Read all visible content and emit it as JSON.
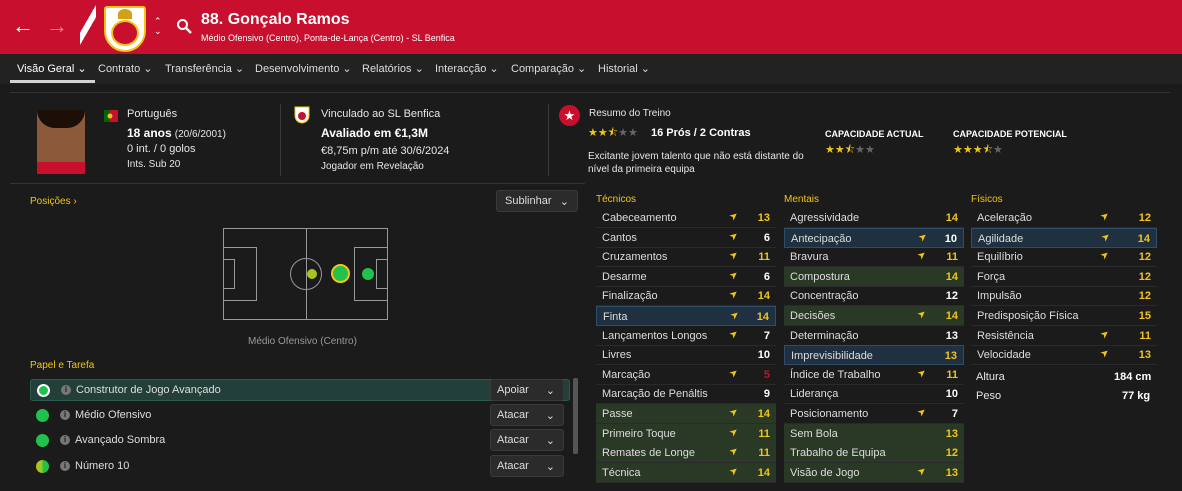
{
  "header": {
    "number_name": "88. Gonçalo Ramos",
    "subtitle": "Médio Ofensivo (Centro), Ponta-de-Lança (Centro) - SL Benfica"
  },
  "nav": {
    "tabs": [
      "Visão Geral",
      "Contrato",
      "Transferência",
      "Desenvolvimento",
      "Relatórios",
      "Interacção",
      "Comparação",
      "Historial"
    ]
  },
  "profile": {
    "nationality": "Português",
    "age": "18 anos",
    "dob": "(20/6/2001)",
    "caps": "0 int. / 0 golos",
    "intl": "Ints. Sub 20"
  },
  "contract": {
    "club": "Vinculado ao SL Benfica",
    "value": "Avaliado em €1,3M",
    "wage": "€8,75m p/m até 30/6/2024",
    "status": "Jogador em Revelação"
  },
  "training": {
    "title": "Resumo do Treino",
    "proscons": "16 Prós / 2 Contras",
    "rating_stars": 2.5,
    "desc_line1": "Excitante jovem talento que não está distante do",
    "desc_line2": "nível da primeira equipa",
    "ca_label": "CAPACIDADE ACTUAL",
    "ca_stars": 2.5,
    "pa_label": "CAPACIDADE POTENCIAL",
    "pa_stars": 3.5
  },
  "positions": {
    "title": "Posições",
    "highlight": "Sublinhar",
    "caption": "Médio Ofensivo (Centro)"
  },
  "roles": {
    "title": "Papel e Tarefa",
    "items": [
      {
        "name": "Construtor de Jogo Avançado",
        "duty": "Apoiar"
      },
      {
        "name": "Médio Ofensivo",
        "duty": "Atacar"
      },
      {
        "name": "Avançado Sombra",
        "duty": "Atacar"
      },
      {
        "name": "Número 10",
        "duty": "Atacar"
      }
    ]
  },
  "attributes": {
    "tecnicos_title": "Técnicos",
    "mentais_title": "Mentais",
    "fisicos_title": "Físicos",
    "tecnicos": [
      {
        "n": "Cabeceamento",
        "v": "13"
      },
      {
        "n": "Cantos",
        "v": "6"
      },
      {
        "n": "Cruzamentos",
        "v": "11"
      },
      {
        "n": "Desarme",
        "v": "6"
      },
      {
        "n": "Finalização",
        "v": "14"
      },
      {
        "n": "Finta",
        "v": "14"
      },
      {
        "n": "Lançamentos Longos",
        "v": "7"
      },
      {
        "n": "Livres",
        "v": "10"
      },
      {
        "n": "Marcação",
        "v": "5"
      },
      {
        "n": "Marcação de Penáltis",
        "v": "9"
      },
      {
        "n": "Passe",
        "v": "14"
      },
      {
        "n": "Primeiro Toque",
        "v": "11"
      },
      {
        "n": "Remates de Longe",
        "v": "11"
      },
      {
        "n": "Técnica",
        "v": "14"
      }
    ],
    "mentais": [
      {
        "n": "Agressividade",
        "v": "14"
      },
      {
        "n": "Antecipação",
        "v": "10"
      },
      {
        "n": "Bravura",
        "v": "11"
      },
      {
        "n": "Compostura",
        "v": "14"
      },
      {
        "n": "Concentração",
        "v": "12"
      },
      {
        "n": "Decisões",
        "v": "14"
      },
      {
        "n": "Determinação",
        "v": "13"
      },
      {
        "n": "Imprevisibilidade",
        "v": "13"
      },
      {
        "n": "Índice de Trabalho",
        "v": "11"
      },
      {
        "n": "Liderança",
        "v": "10"
      },
      {
        "n": "Posicionamento",
        "v": "7"
      },
      {
        "n": "Sem Bola",
        "v": "13"
      },
      {
        "n": "Trabalho de Equipa",
        "v": "12"
      },
      {
        "n": "Visão de Jogo",
        "v": "13"
      }
    ],
    "fisicos": [
      {
        "n": "Aceleração",
        "v": "12"
      },
      {
        "n": "Agilidade",
        "v": "14"
      },
      {
        "n": "Equilíbrio",
        "v": "12"
      },
      {
        "n": "Força",
        "v": "12"
      },
      {
        "n": "Impulsão",
        "v": "12"
      },
      {
        "n": "Predisposição Física",
        "v": "15"
      },
      {
        "n": "Resistência",
        "v": "11"
      },
      {
        "n": "Velocidade",
        "v": "13"
      }
    ],
    "height_label": "Altura",
    "height": "184 cm",
    "weight_label": "Peso",
    "weight": "77 kg"
  },
  "colors": {
    "header": "#c8102e",
    "accent": "#f0c419",
    "role_green": "#21c24b"
  }
}
